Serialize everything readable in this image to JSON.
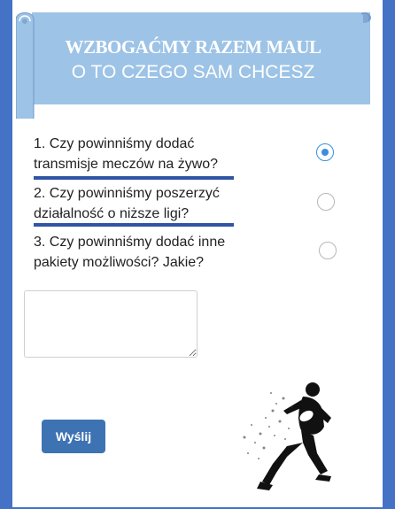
{
  "banner": {
    "title": "WZBOGAĆMY RAZEM MAUL",
    "subtitle": "O TO CZEGO SAM CHCESZ"
  },
  "questions": [
    {
      "line1": "1. Czy powinniśmy dodać",
      "line2": "transmisje meczów na żywo?",
      "selected": true
    },
    {
      "line1": "2. Czy powinniśmy poszerzyć",
      "line2": "działalność o niższe ligi?",
      "selected": false
    },
    {
      "line1": "3. Czy powinniśmy dodać inne",
      "line2": "pakiety możliwości? Jakie?",
      "selected": false
    }
  ],
  "answer": {
    "value": "",
    "placeholder": ""
  },
  "submit_label": "Wyślij",
  "colors": {
    "background": "#4472c4",
    "banner": "#9dc3e6",
    "button": "#3d73b3",
    "radio_selected": "#3b8ee0"
  },
  "icons": [
    "rugby-player-icon"
  ]
}
